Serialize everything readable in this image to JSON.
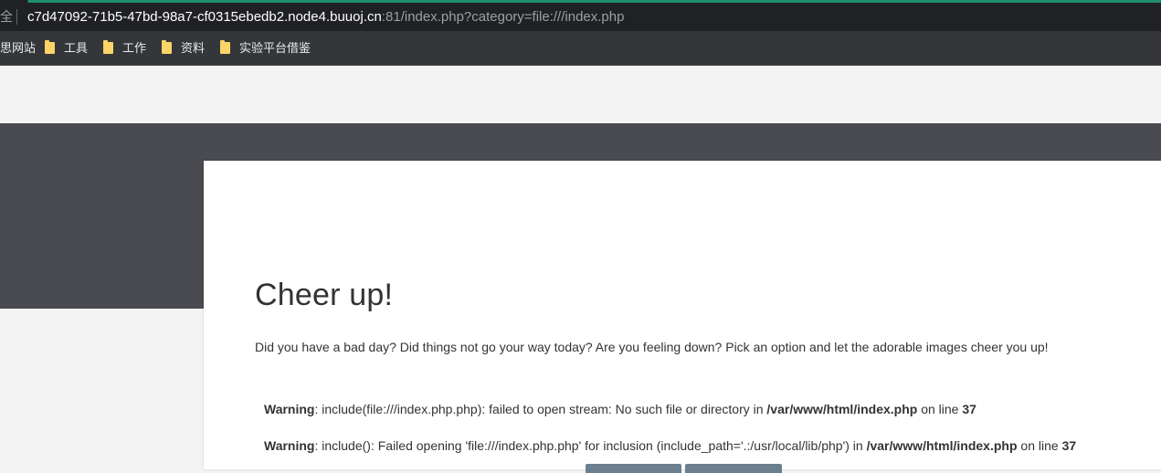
{
  "browser": {
    "security_label": "全",
    "url_host": "c7d47092-71b5-47bd-98a7-cf0315ebedb2.node4.buuoj.cn",
    "url_rest": ":81/index.php?category=file:///index.php",
    "bookmarks": [
      {
        "label": "思网站",
        "icon": "none"
      },
      {
        "label": "工具",
        "icon": "folder-icon"
      },
      {
        "label": "工作",
        "icon": "folder-icon"
      },
      {
        "label": "资料",
        "icon": "folder-icon"
      },
      {
        "label": "实验平台借鉴",
        "icon": "folder-icon"
      }
    ],
    "colors": {
      "toolbar": "#202124",
      "bookmarks_bar": "#35363a",
      "folder": "#fcd468",
      "accent": "#1f8f6e"
    }
  },
  "page": {
    "title": "Cheer up!",
    "lead": "Did you have a bad day? Did things not go your way today? Are you feeling down? Pick an option and let the adorable images cheer you up!",
    "warnings": [
      {
        "label": "Warning",
        "text": ": include(file:///index.php.php): failed to open stream: No such file or directory in ",
        "path": "/var/www/html/index.php",
        "on_line": " on line ",
        "line": "37"
      },
      {
        "label": "Warning",
        "text": ": include(): Failed opening 'file:///index.php.php' for inclusion (include_path='.:/usr/local/lib/php') in ",
        "path": "/var/www/html/index.php",
        "on_line": " on line ",
        "line": "37"
      }
    ],
    "colors": {
      "background": "#f4f4f4",
      "band": "#4a4b51",
      "card": "#ffffff",
      "button": "#6b7f8e"
    }
  }
}
